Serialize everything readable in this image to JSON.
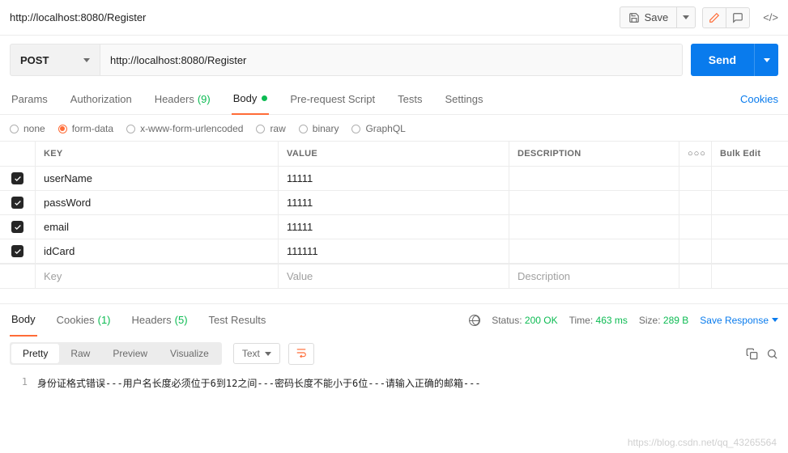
{
  "header": {
    "title": "http://localhost:8080/Register",
    "save_label": "Save"
  },
  "request": {
    "method": "POST",
    "url": "http://localhost:8080/Register",
    "send_label": "Send"
  },
  "tabs": {
    "params": "Params",
    "authorization": "Authorization",
    "headers": "Headers",
    "headers_count": "(9)",
    "body": "Body",
    "prerequest": "Pre-request Script",
    "tests": "Tests",
    "settings": "Settings",
    "cookies_link": "Cookies"
  },
  "body_types": {
    "none": "none",
    "formdata": "form-data",
    "xwww": "x-www-form-urlencoded",
    "raw": "raw",
    "binary": "binary",
    "graphql": "GraphQL"
  },
  "kv": {
    "key_header": "KEY",
    "value_header": "VALUE",
    "desc_header": "DESCRIPTION",
    "bulk_label": "Bulk Edit",
    "rows": [
      {
        "key": "userName",
        "value": "11111"
      },
      {
        "key": "passWord",
        "value": "11111"
      },
      {
        "key": "email",
        "value": "11111"
      },
      {
        "key": "idCard",
        "value": "111111"
      }
    ],
    "placeholder": {
      "key": "Key",
      "value": "Value",
      "desc": "Description"
    }
  },
  "response": {
    "tabs": {
      "body": "Body",
      "cookies": "Cookies",
      "cookies_count": "(1)",
      "headers": "Headers",
      "headers_count": "(5)",
      "test_results": "Test Results"
    },
    "status_label": "Status:",
    "status_value": "200 OK",
    "time_label": "Time:",
    "time_value": "463 ms",
    "size_label": "Size:",
    "size_value": "289 B",
    "save_response": "Save Response",
    "view": {
      "pretty": "Pretty",
      "raw": "Raw",
      "preview": "Preview",
      "visualize": "Visualize",
      "lang": "Text"
    },
    "body_text": "身份证格式错误---用户名长度必须位于6到12之间---密码长度不能小于6位---请输入正确的邮箱---",
    "line_no": "1"
  },
  "watermark": "https://blog.csdn.net/qq_43265564"
}
